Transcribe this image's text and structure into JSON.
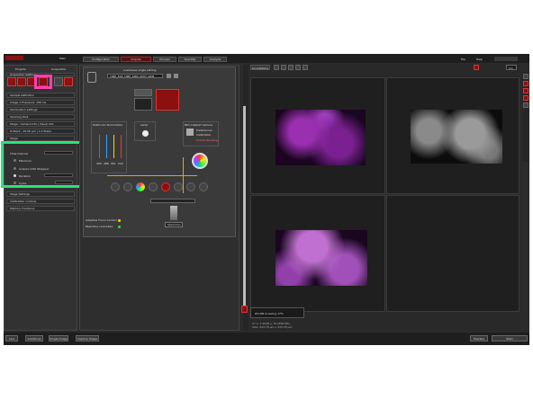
{
  "top_tabs": [
    "Configuration",
    "Acquire",
    "Process",
    "Quantify",
    "Analysis"
  ],
  "top_right": {
    "help": "Help",
    "menu_left": "File",
    "account": "Main"
  },
  "left": {
    "tabs": [
      "Projects",
      "Acquisition"
    ],
    "rows": [
      "Acquisition Settings",
      "Sample Definition",
      "Image 1 Exposure: 156 ms",
      "Illumination settings",
      "Spinning Disk",
      "Stage - Camera Info | Visual Info",
      "Z-Stack - 15.00 µm | 1.0 Steps",
      "Stage"
    ],
    "lower_rows": [
      "Stage Settings",
      "Calibration controls",
      "Memory Functions"
    ],
    "time": {
      "header": "Time Interval",
      "opt1": "Minimum",
      "opt2": "Acquire Until Stopped",
      "opt3": "Duration",
      "opt4": "Cycle"
    }
  },
  "mid": {
    "title": "Load/save single setting",
    "dropdown": "TIME_EXP_TIME_SPIN_SPOT_SPIN",
    "multicolor": "Multicolor Illumination",
    "lamp": "Lamp",
    "camera": "NN | Default Camera",
    "prefs": "Preferences",
    "calib": "Calibration",
    "unlock": "Unlock Readings",
    "slider_labels": [
      "405",
      "488",
      "561",
      "640"
    ],
    "focus": "Adaptive Focus Control",
    "realtime": "Real time controlled",
    "specimen": "Specimen"
  },
  "right": {
    "tab": "Annotations",
    "zoom": "4.1",
    "status": "#1-NN is saving 17%",
    "meta1": "27  x: 1   2048  y: 70   (ZSR RB)",
    "meta2": "Size: 333.78 µm x 333.78 µm"
  },
  "footer": {
    "buttons": [
      "Live",
      "Autofocus",
      "Single Image",
      "Capture Image"
    ],
    "right": [
      "Preview",
      "Start"
    ]
  },
  "colors": {
    "accent_red": "#a11010",
    "highlight_green": "#2ee07a",
    "highlight_pink": "#ff3fb3",
    "cells": "#b040c0"
  }
}
